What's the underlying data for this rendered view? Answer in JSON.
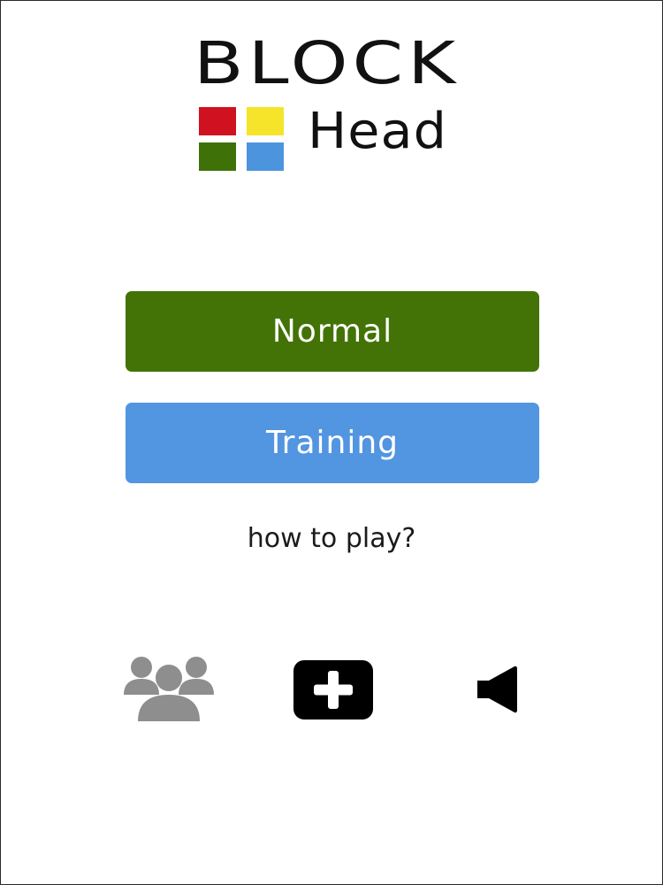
{
  "logo": {
    "title": "BLOCK",
    "subtitle": "Head",
    "blocks": [
      {
        "name": "red-block",
        "color": "#d0111f"
      },
      {
        "name": "yellow-block",
        "color": "#f5e42a"
      },
      {
        "name": "green-block",
        "color": "#3f7109"
      },
      {
        "name": "blue-block",
        "color": "#4d94de"
      }
    ]
  },
  "menu": {
    "normal_label": "Normal",
    "training_label": "Training",
    "how_to_play_label": "how to play?"
  },
  "colors": {
    "normal_button": "#437306",
    "training_button": "#5295e0",
    "multiplayer_icon": "#8e8e8e",
    "add_icon": "#000000",
    "sound_icon": "#000000"
  },
  "icons": {
    "multiplayer": "group-people-icon",
    "add": "plus-square-icon",
    "sound": "speaker-icon"
  }
}
